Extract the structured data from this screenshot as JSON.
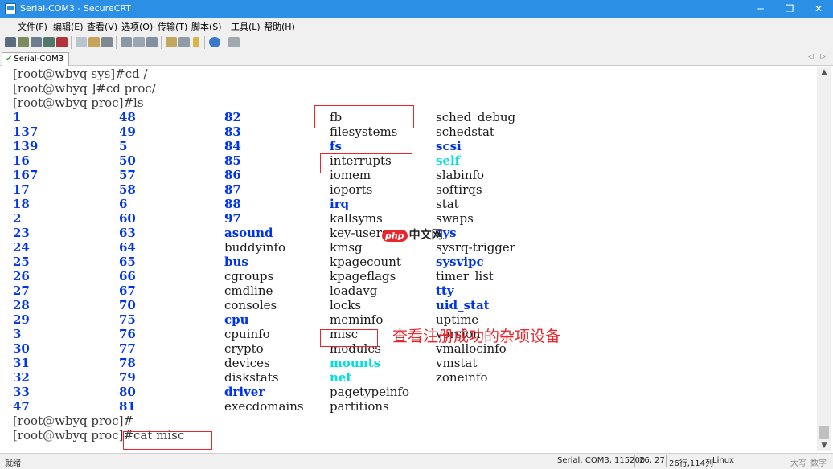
{
  "window": {
    "title": "Serial-COM3 - SecureCRT",
    "app_icon": "securecrt-icon",
    "controls": [
      "minimize-icon",
      "restore-icon",
      "close-icon"
    ]
  },
  "menu": [
    "文件(F)",
    "编辑(E)",
    "查看(V)",
    "选项(O)",
    "传输(T)",
    "脚本(S)",
    "工具(L)",
    "帮助(H)"
  ],
  "toolbar": {
    "icons": [
      "connect-icon",
      "quick-connect-icon",
      "connect-tab-icon",
      "reconnect-icon",
      "disconnect-icon",
      "copy-icon",
      "paste-icon",
      "find-icon",
      "print-icon",
      "print-selection-icon",
      "print-setup-icon",
      "session-options-icon",
      "global-options-icon",
      "keymap-icon",
      "help-icon",
      "sftp-icon"
    ]
  },
  "tabs": [
    {
      "label": "Serial-COM3",
      "active": true,
      "status_icon": "connected-check-icon"
    }
  ],
  "tab_nav": [
    "◁",
    "▷"
  ],
  "terminal": {
    "lines": [
      "[root@wbyq sys]#cd /",
      "[root@wbyq ]#cd proc/",
      "[root@wbyq proc]#ls"
    ],
    "ls_columns": [
      [
        {
          "t": "1",
          "c": "blue"
        },
        {
          "t": "137",
          "c": "blue"
        },
        {
          "t": "139",
          "c": "blue"
        },
        {
          "t": "16",
          "c": "blue"
        },
        {
          "t": "167",
          "c": "blue"
        },
        {
          "t": "17",
          "c": "blue"
        },
        {
          "t": "18",
          "c": "blue"
        },
        {
          "t": "2",
          "c": "blue"
        },
        {
          "t": "23",
          "c": "blue"
        },
        {
          "t": "24",
          "c": "blue"
        },
        {
          "t": "25",
          "c": "blue"
        },
        {
          "t": "26",
          "c": "blue"
        },
        {
          "t": "27",
          "c": "blue"
        },
        {
          "t": "28",
          "c": "blue"
        },
        {
          "t": "29",
          "c": "blue"
        },
        {
          "t": "3",
          "c": "blue"
        },
        {
          "t": "30",
          "c": "blue"
        },
        {
          "t": "31",
          "c": "blue"
        },
        {
          "t": "32",
          "c": "blue"
        },
        {
          "t": "33",
          "c": "blue"
        },
        {
          "t": "47",
          "c": "blue"
        }
      ],
      [
        {
          "t": "48",
          "c": "blue"
        },
        {
          "t": "49",
          "c": "blue"
        },
        {
          "t": "5",
          "c": "blue"
        },
        {
          "t": "50",
          "c": "blue"
        },
        {
          "t": "57",
          "c": "blue"
        },
        {
          "t": "58",
          "c": "blue"
        },
        {
          "t": "6",
          "c": "blue"
        },
        {
          "t": "60",
          "c": "blue"
        },
        {
          "t": "63",
          "c": "blue"
        },
        {
          "t": "64",
          "c": "blue"
        },
        {
          "t": "65",
          "c": "blue"
        },
        {
          "t": "66",
          "c": "blue"
        },
        {
          "t": "67",
          "c": "blue"
        },
        {
          "t": "70",
          "c": "blue"
        },
        {
          "t": "75",
          "c": "blue"
        },
        {
          "t": "76",
          "c": "blue"
        },
        {
          "t": "77",
          "c": "blue"
        },
        {
          "t": "78",
          "c": "blue"
        },
        {
          "t": "79",
          "c": "blue"
        },
        {
          "t": "80",
          "c": "blue"
        },
        {
          "t": "81",
          "c": "blue"
        }
      ],
      [
        {
          "t": "82",
          "c": "blue"
        },
        {
          "t": "83",
          "c": "blue"
        },
        {
          "t": "84",
          "c": "blue"
        },
        {
          "t": "85",
          "c": "blue"
        },
        {
          "t": "86",
          "c": "blue"
        },
        {
          "t": "87",
          "c": "blue"
        },
        {
          "t": "88",
          "c": "blue"
        },
        {
          "t": "97",
          "c": "blue"
        },
        {
          "t": "asound",
          "c": "blue"
        },
        {
          "t": "buddyinfo",
          "c": "plain"
        },
        {
          "t": "bus",
          "c": "blue"
        },
        {
          "t": "cgroups",
          "c": "plain"
        },
        {
          "t": "cmdline",
          "c": "plain"
        },
        {
          "t": "consoles",
          "c": "plain"
        },
        {
          "t": "cpu",
          "c": "blue"
        },
        {
          "t": "cpuinfo",
          "c": "plain"
        },
        {
          "t": "crypto",
          "c": "plain"
        },
        {
          "t": "devices",
          "c": "plain"
        },
        {
          "t": "diskstats",
          "c": "plain"
        },
        {
          "t": "driver",
          "c": "blue"
        },
        {
          "t": "execdomains",
          "c": "plain"
        }
      ],
      [
        {
          "t": "fb",
          "c": "plain"
        },
        {
          "t": "filesystems",
          "c": "plain"
        },
        {
          "t": "fs",
          "c": "blue"
        },
        {
          "t": "interrupts",
          "c": "plain"
        },
        {
          "t": "iomem",
          "c": "plain"
        },
        {
          "t": "ioports",
          "c": "plain"
        },
        {
          "t": "irq",
          "c": "blue"
        },
        {
          "t": "kallsyms",
          "c": "plain"
        },
        {
          "t": "key-users",
          "c": "plain"
        },
        {
          "t": "kmsg",
          "c": "plain"
        },
        {
          "t": "kpagecount",
          "c": "plain"
        },
        {
          "t": "kpageflags",
          "c": "plain"
        },
        {
          "t": "loadavg",
          "c": "plain"
        },
        {
          "t": "locks",
          "c": "plain"
        },
        {
          "t": "meminfo",
          "c": "plain"
        },
        {
          "t": "misc",
          "c": "plain"
        },
        {
          "t": "modules",
          "c": "plain"
        },
        {
          "t": "mounts",
          "c": "cyan"
        },
        {
          "t": "net",
          "c": "cyan"
        },
        {
          "t": "pagetypeinfo",
          "c": "plain"
        },
        {
          "t": "partitions",
          "c": "plain"
        }
      ],
      [
        {
          "t": "sched_debug",
          "c": "plain"
        },
        {
          "t": "schedstat",
          "c": "plain"
        },
        {
          "t": "scsi",
          "c": "blue"
        },
        {
          "t": "self",
          "c": "cyan"
        },
        {
          "t": "slabinfo",
          "c": "plain"
        },
        {
          "t": "softirqs",
          "c": "plain"
        },
        {
          "t": "stat",
          "c": "plain"
        },
        {
          "t": "swaps",
          "c": "plain"
        },
        {
          "t": "sys",
          "c": "blue"
        },
        {
          "t": "sysrq-trigger",
          "c": "plain"
        },
        {
          "t": "sysvipc",
          "c": "blue"
        },
        {
          "t": "timer_list",
          "c": "plain"
        },
        {
          "t": "tty",
          "c": "blue"
        },
        {
          "t": "uid_stat",
          "c": "blue"
        },
        {
          "t": "uptime",
          "c": "plain"
        },
        {
          "t": "version",
          "c": "plain"
        },
        {
          "t": "vmallocinfo",
          "c": "plain"
        },
        {
          "t": "vmstat",
          "c": "plain"
        },
        {
          "t": "zoneinfo",
          "c": "plain"
        }
      ]
    ],
    "after_lines": [
      "[root@wbyq proc]#",
      "[root@wbyq proc]#cat misc"
    ]
  },
  "annotation": "查看注册成功的杂项设备",
  "watermark": {
    "badge": "php",
    "text": "中文网"
  },
  "status_bar": {
    "ready": "就绪",
    "connection": "Serial: COM3, 115200",
    "cursor": "26,  27",
    "size": "26行,114列",
    "terminal_type": "Linux",
    "caps": "大写",
    "num": "数字"
  },
  "colors": {
    "titlebar": "#2b8fe6",
    "dir_blue": "#0033ee",
    "link_cyan": "#00dede",
    "annotation_red": "#e8262b"
  }
}
